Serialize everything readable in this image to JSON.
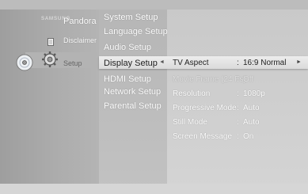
{
  "left_menu": {
    "brand": "SAMSUNG",
    "items": [
      {
        "label": "Pandora"
      },
      {
        "label": "Disclaimer"
      },
      {
        "label": "Setup"
      }
    ]
  },
  "setup_menu": {
    "items": [
      "System Setup",
      "Language Setup",
      "Audio Setup",
      "Display Setup",
      "HDMI Setup",
      "Network Setup",
      "Parental Setup"
    ]
  },
  "display_settings": {
    "rows": [
      {
        "label": "TV Aspect",
        "value": "16:9 Normal"
      },
      {
        "label": "Movie Frame (24 Fs)",
        "value": "Off"
      },
      {
        "label": "Resolution",
        "value": "1080p"
      },
      {
        "label": "Progressive Mode",
        "value": "Auto"
      },
      {
        "label": "Still Mode",
        "value": "Auto"
      },
      {
        "label": "Screen Message",
        "value": "On"
      }
    ],
    "separator": ":"
  },
  "icons": {
    "disc": "disc-icon",
    "disclaimer": "document-icon",
    "setup": "gear-icon",
    "submenu_arrow": "arrow-left-icon",
    "value_arrow": "arrow-right-icon"
  }
}
